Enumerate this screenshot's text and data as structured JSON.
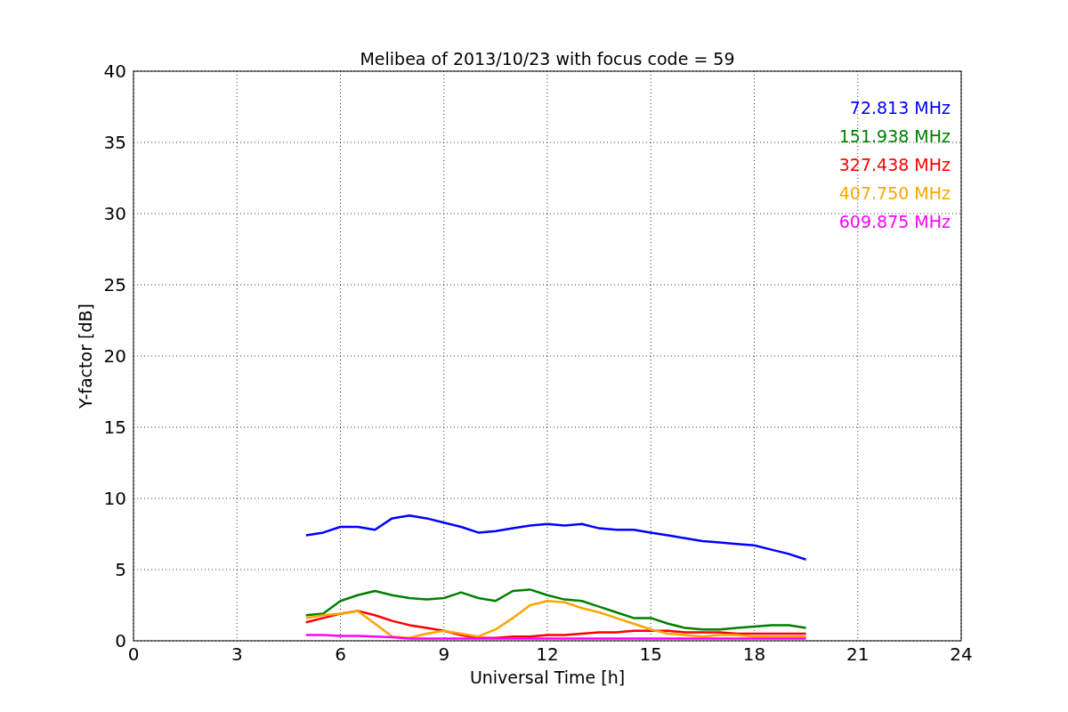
{
  "chart_data": {
    "type": "line",
    "title": "Melibea of 2013/10/23 with focus code = 59",
    "xlabel": "Universal Time [h]",
    "ylabel": "Y-factor [dB]",
    "x": [
      5,
      5.5,
      6,
      6.5,
      7,
      7.5,
      8,
      8.5,
      9,
      9.5,
      10,
      10.5,
      11,
      11.5,
      12,
      12.5,
      13,
      13.5,
      14,
      14.5,
      15,
      15.5,
      16,
      16.5,
      17,
      17.5,
      18,
      18.5,
      19,
      19.5
    ],
    "grid": true,
    "xlim": [
      0,
      24
    ],
    "ylim": [
      0,
      40
    ],
    "xticks": [
      0,
      3,
      6,
      9,
      12,
      15,
      18,
      21,
      24
    ],
    "yticks": [
      0,
      5,
      10,
      15,
      20,
      25,
      30,
      35,
      40
    ],
    "series": [
      {
        "name": "72.813 MHz",
        "color": "#0000ff",
        "values": [
          7.4,
          7.6,
          8.0,
          8.0,
          7.8,
          8.6,
          8.8,
          8.6,
          8.3,
          8.0,
          7.6,
          7.7,
          7.9,
          8.1,
          8.2,
          8.1,
          8.2,
          7.9,
          7.8,
          7.8,
          7.6,
          7.4,
          7.2,
          7.0,
          6.9,
          6.8,
          6.7,
          6.4,
          6.1,
          5.7
        ]
      },
      {
        "name": "151.938 MHz",
        "color": "#008000",
        "values": [
          1.8,
          1.9,
          2.8,
          3.2,
          3.5,
          3.2,
          3.0,
          2.9,
          3.0,
          3.4,
          3.0,
          2.8,
          3.5,
          3.6,
          3.2,
          2.9,
          2.8,
          2.4,
          2.0,
          1.6,
          1.6,
          1.2,
          0.9,
          0.8,
          0.8,
          0.9,
          1.0,
          1.1,
          1.1,
          0.9
        ]
      },
      {
        "name": "327.438 MHz",
        "color": "#ff0000",
        "values": [
          1.3,
          1.6,
          1.9,
          2.1,
          1.8,
          1.4,
          1.1,
          0.9,
          0.7,
          0.4,
          0.2,
          0.2,
          0.3,
          0.3,
          0.4,
          0.4,
          0.5,
          0.6,
          0.6,
          0.7,
          0.7,
          0.7,
          0.6,
          0.6,
          0.6,
          0.5,
          0.5,
          0.5,
          0.5,
          0.5
        ]
      },
      {
        "name": "407.750 MHz",
        "color": "#ffa500",
        "values": [
          1.6,
          1.8,
          1.9,
          2.1,
          1.2,
          0.3,
          0.2,
          0.5,
          0.7,
          0.5,
          0.3,
          0.8,
          1.6,
          2.5,
          2.8,
          2.7,
          2.3,
          2.0,
          1.6,
          1.2,
          0.8,
          0.5,
          0.4,
          0.3,
          0.4,
          0.4,
          0.3,
          0.3,
          0.3,
          0.3
        ]
      },
      {
        "name": "609.875 MHz",
        "color": "#ff00ff",
        "values": [
          0.4,
          0.4,
          0.35,
          0.35,
          0.3,
          0.25,
          0.15,
          0.15,
          0.15,
          0.15,
          0.15,
          0.15,
          0.15,
          0.15,
          0.15,
          0.15,
          0.15,
          0.15,
          0.15,
          0.15,
          0.15,
          0.15,
          0.15,
          0.15,
          0.15,
          0.15,
          0.15,
          0.15,
          0.15,
          0.15
        ]
      }
    ]
  }
}
